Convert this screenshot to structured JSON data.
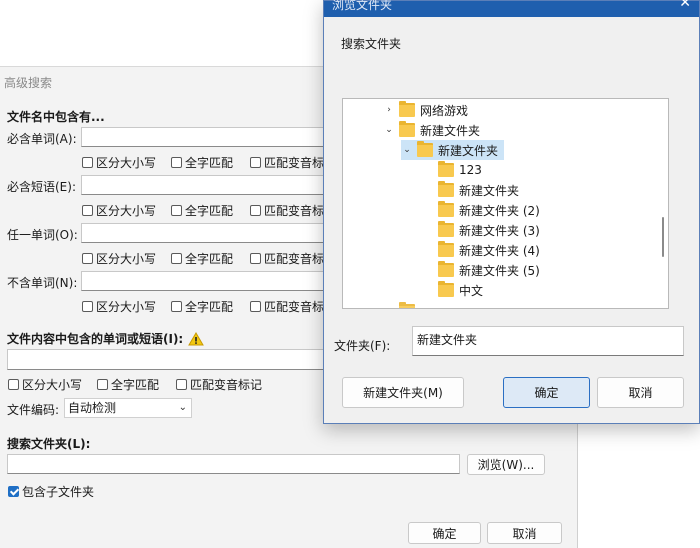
{
  "advanced": {
    "title": "高级搜索",
    "filename_section": "文件名中包含有...",
    "fields": [
      {
        "label": "必含单词(A):"
      },
      {
        "label": "必含短语(E):"
      },
      {
        "label": "任一单词(O):"
      },
      {
        "label": "不含单词(N):"
      }
    ],
    "opt_case": "区分大小写",
    "opt_whole": "全字匹配",
    "opt_diacritic_cut": "匹配变音标",
    "content_section": "文件内容中包含的单词或短语(I):",
    "content_opts": {
      "case": "区分大小写",
      "whole": "全字匹配",
      "diacritic": "匹配变音标记"
    },
    "encoding_label": "文件编码:",
    "encoding_value": "自动检测",
    "search_folder_section": "搜索文件夹(L):",
    "browse_label": "浏览(W)...",
    "include_sub": "包含子文件夹",
    "ok": "确定",
    "cancel": "取消"
  },
  "browse": {
    "title": "浏览文件夹",
    "description": "搜索文件夹",
    "tree": [
      {
        "label": "网络游戏",
        "twisty": "›"
      },
      {
        "label": "新建文件夹",
        "twisty": "⌄"
      },
      {
        "label": "新建文件夹",
        "twisty": "⌄"
      },
      {
        "label": "123"
      },
      {
        "label": "新建文件夹"
      },
      {
        "label": "新建文件夹 (2)"
      },
      {
        "label": "新建文件夹 (3)"
      },
      {
        "label": "新建文件夹 (4)"
      },
      {
        "label": "新建文件夹 (5)"
      },
      {
        "label": "中文"
      }
    ],
    "folder_label": "文件夹(F):",
    "folder_value": "新建文件夹",
    "new_folder": "新建文件夹(M)",
    "ok": "确定",
    "cancel": "取消"
  },
  "colors": {
    "accent": "#1f5fae",
    "folder": "#f8c94f",
    "selection": "#cce4f7",
    "warning": "#f2c811"
  }
}
